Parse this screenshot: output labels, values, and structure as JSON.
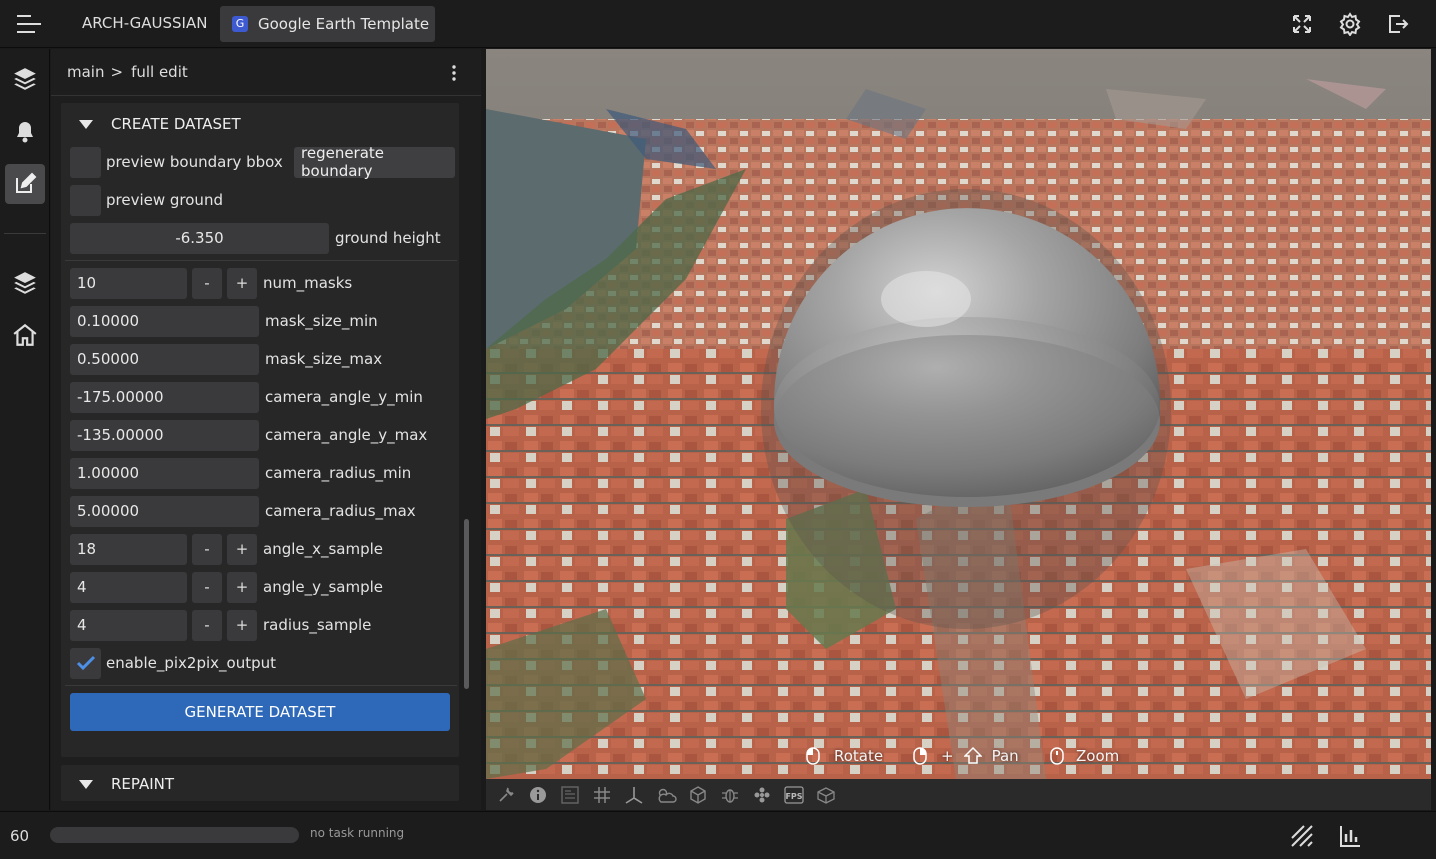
{
  "header": {
    "app_name": "ARCH-GAUSSIAN",
    "tab_badge": "G",
    "tab_label": "Google Earth Template"
  },
  "breadcrumb": {
    "root": "main",
    "separator": ">",
    "current": "full edit"
  },
  "create_dataset": {
    "title": "CREATE DATASET",
    "preview_boundary_label": "preview boundary bbox",
    "regenerate_boundary_label": "regenerate boundary",
    "preview_ground_label": "preview ground",
    "ground_height_value": "-6.350",
    "ground_height_label": "ground height",
    "num_masks_value": "10",
    "num_masks_label": "num_masks",
    "mask_size_min_value": "0.10000",
    "mask_size_min_label": "mask_size_min",
    "mask_size_max_value": "0.50000",
    "mask_size_max_label": "mask_size_max",
    "camera_angle_y_min_value": "-175.00000",
    "camera_angle_y_min_label": "camera_angle_y_min",
    "camera_angle_y_max_value": "-135.00000",
    "camera_angle_y_max_label": "camera_angle_y_max",
    "camera_radius_min_value": "1.00000",
    "camera_radius_min_label": "camera_radius_min",
    "camera_radius_max_value": "5.00000",
    "camera_radius_max_label": "camera_radius_max",
    "angle_x_sample_value": "18",
    "angle_x_sample_label": "angle_x_sample",
    "angle_y_sample_value": "4",
    "angle_y_sample_label": "angle_y_sample",
    "radius_sample_value": "4",
    "radius_sample_label": "radius_sample",
    "enable_pix2pix_label": "enable_pix2pix_output",
    "enable_pix2pix_checked": true,
    "minus": "-",
    "plus": "+",
    "generate_button": "GENERATE DATASET"
  },
  "repaint": {
    "title": "REPAINT"
  },
  "viewport": {
    "hint_rotate": "Rotate",
    "hint_plus": "+",
    "hint_pan": "Pan",
    "hint_zoom": "Zoom",
    "toolbar_fps": "FPS"
  },
  "status": {
    "fps_value": "60",
    "task_text": "no task running",
    "progress": 0
  },
  "colors": {
    "accent": "#2e68b8",
    "panel": "#272728",
    "input": "#3a3a3c"
  }
}
